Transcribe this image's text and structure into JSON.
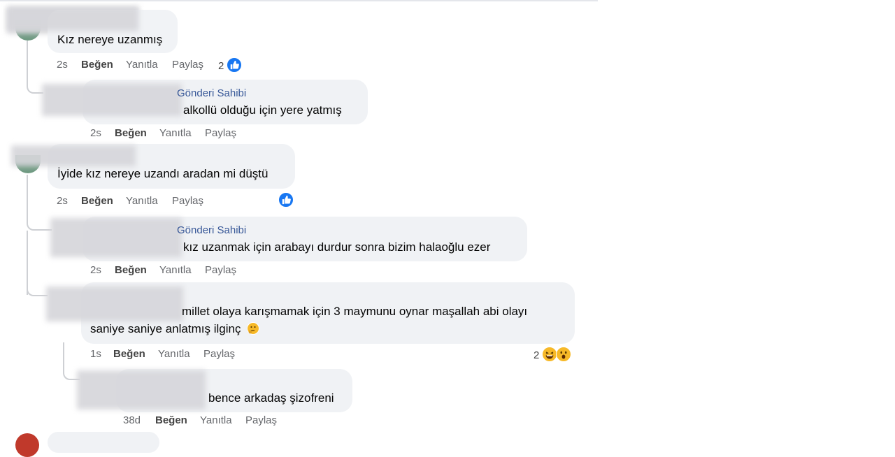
{
  "comments": [
    {
      "text": "Kız nereye uzanmış",
      "actions": {
        "time": "2s",
        "like": "Beğen",
        "reply": "Yanıtla",
        "share": "Paylaş"
      },
      "reaction_count": "2"
    },
    {
      "author_badge": "Gönderi Sahibi",
      "text": "alkollü olduğu için yere yatmış",
      "actions": {
        "time": "2s",
        "like": "Beğen",
        "reply": "Yanıtla",
        "share": "Paylaş"
      }
    },
    {
      "text": "İyide kız nereye uzandı aradan mi düştü",
      "actions": {
        "time": "2s",
        "like": "Beğen",
        "reply": "Yanıtla",
        "share": "Paylaş"
      }
    },
    {
      "author_badge": "Gönderi Sahibi",
      "text": "kız uzanmak için arabayı durdur sonra bizim halaoğlu ezer",
      "actions": {
        "time": "2s",
        "like": "Beğen",
        "reply": "Yanıtla",
        "share": "Paylaş"
      }
    },
    {
      "text_line1": "millet olaya karışmamak için 3 maymunu oynar maşallah abi olayı",
      "text_line2": "saniye saniye anlatmış ilginç",
      "actions": {
        "time": "1s",
        "like": "Beğen",
        "reply": "Yanıtla",
        "share": "Paylaş"
      },
      "reaction_count": "2"
    },
    {
      "text": "bence arkadaş şizofreni",
      "actions": {
        "time": "38d",
        "like": "Beğen",
        "reply": "Yanıtla",
        "share": "Paylaş"
      }
    }
  ],
  "colors": {
    "bubble": "#f0f2f5",
    "like_blue": "#1877f2",
    "author": "#385898",
    "meta": "#65676b"
  },
  "icons": [
    "like-icon",
    "laughing-emoji-icon",
    "wow-emoji-icon",
    "thinking-emoji-icon"
  ]
}
